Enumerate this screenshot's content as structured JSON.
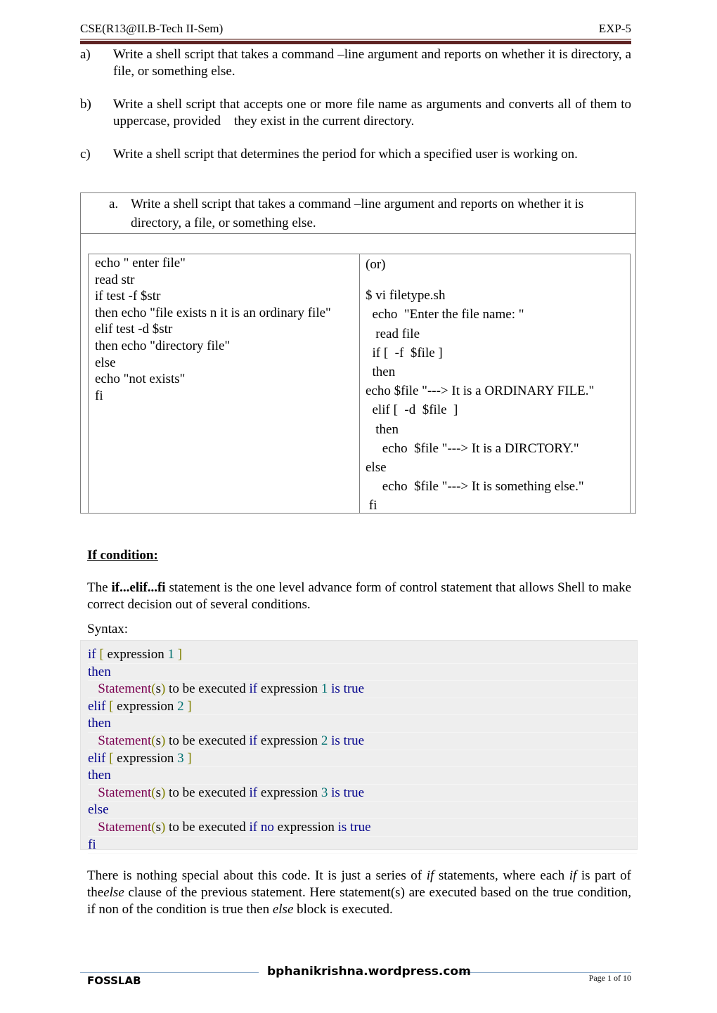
{
  "header": {
    "left": "CSE(R13@II.B-Tech II-Sem)",
    "right": "EXP-5"
  },
  "tasks": [
    {
      "mark": "a)",
      "text": "Write a shell script that takes a command –line argument and reports on whether it is directory, a file, or something else."
    },
    {
      "mark": "b)",
      "text": "Write a shell script that accepts one or more file name as arguments and converts all of them to uppercase, provided    they exist in the current directory."
    },
    {
      "mark": "c)",
      "text": "Write a shell script that determines the period for which a specified user is working on."
    }
  ],
  "outer_table": {
    "mark": "a.",
    "text": "Write a shell script that takes a command –line argument and reports on whether it is directory, a file, or something else."
  },
  "left_code": [
    "echo \" enter file\"",
    "read str",
    "if test -f $str",
    "then echo \"file exists n it is an ordinary file\"",
    "elif test -d $str",
    "then echo \"directory file\"",
    "else",
    "echo \"not exists\"",
    "fi"
  ],
  "right_code": {
    "or_label": "(or)",
    "lines": [
      "$ vi filetype.sh",
      "  echo  \"Enter the file name: \"",
      "   read file",
      "  if [  -f  $file ]",
      "  then",
      "echo $file \"---> It is a ORDINARY FILE.\"",
      "  elif [  -d  $file  ]",
      "   then",
      "     echo  $file \"---> It is a DIRCTORY.\"",
      "else",
      "     echo  $file \"---> It is something else.\"",
      " fi"
    ]
  },
  "if_section": {
    "heading": "If condition:",
    "intro_prefix": "The ",
    "intro_bold": "if...elif...fi",
    "intro_suffix": " statement is the one level advance form of control statement that allows Shell to make correct decision out of several conditions.",
    "syntax_label": "Syntax:"
  },
  "syntax_code": [
    [
      {
        "t": "if",
        "c": "kw"
      },
      {
        "t": " ",
        "c": "plain"
      },
      {
        "t": "[",
        "c": "br"
      },
      {
        "t": " expression ",
        "c": "plain"
      },
      {
        "t": "1",
        "c": "num"
      },
      {
        "t": " ",
        "c": "plain"
      },
      {
        "t": "]",
        "c": "br"
      }
    ],
    [
      {
        "t": "then",
        "c": "kw"
      }
    ],
    [
      {
        "t": "   Statement",
        "c": "stmt"
      },
      {
        "t": "(",
        "c": "br"
      },
      {
        "t": "s",
        "c": "plain"
      },
      {
        "t": ")",
        "c": "br"
      },
      {
        "t": " to be executed ",
        "c": "plain"
      },
      {
        "t": "if",
        "c": "kw"
      },
      {
        "t": " expression ",
        "c": "plain"
      },
      {
        "t": "1",
        "c": "num"
      },
      {
        "t": " ",
        "c": "plain"
      },
      {
        "t": "is true",
        "c": "kw"
      }
    ],
    [
      {
        "t": "elif",
        "c": "kw"
      },
      {
        "t": " ",
        "c": "plain"
      },
      {
        "t": "[",
        "c": "br"
      },
      {
        "t": " expression ",
        "c": "plain"
      },
      {
        "t": "2",
        "c": "num"
      },
      {
        "t": " ",
        "c": "plain"
      },
      {
        "t": "]",
        "c": "br"
      }
    ],
    [
      {
        "t": "then",
        "c": "kw"
      }
    ],
    [
      {
        "t": "   Statement",
        "c": "stmt"
      },
      {
        "t": "(",
        "c": "br"
      },
      {
        "t": "s",
        "c": "plain"
      },
      {
        "t": ")",
        "c": "br"
      },
      {
        "t": " to be executed ",
        "c": "plain"
      },
      {
        "t": "if",
        "c": "kw"
      },
      {
        "t": " expression ",
        "c": "plain"
      },
      {
        "t": "2",
        "c": "num"
      },
      {
        "t": " ",
        "c": "plain"
      },
      {
        "t": "is true",
        "c": "kw"
      }
    ],
    [
      {
        "t": "elif",
        "c": "kw"
      },
      {
        "t": " ",
        "c": "plain"
      },
      {
        "t": "[",
        "c": "br"
      },
      {
        "t": " expression ",
        "c": "plain"
      },
      {
        "t": "3",
        "c": "num"
      },
      {
        "t": " ",
        "c": "plain"
      },
      {
        "t": "]",
        "c": "br"
      }
    ],
    [
      {
        "t": "then",
        "c": "kw"
      }
    ],
    [
      {
        "t": "   Statement",
        "c": "stmt"
      },
      {
        "t": "(",
        "c": "br"
      },
      {
        "t": "s",
        "c": "plain"
      },
      {
        "t": ")",
        "c": "br"
      },
      {
        "t": " to be executed ",
        "c": "plain"
      },
      {
        "t": "if",
        "c": "kw"
      },
      {
        "t": " expression ",
        "c": "plain"
      },
      {
        "t": "3",
        "c": "num"
      },
      {
        "t": " ",
        "c": "plain"
      },
      {
        "t": "is true",
        "c": "kw"
      }
    ],
    [
      {
        "t": "else",
        "c": "kw"
      }
    ],
    [
      {
        "t": "   Statement",
        "c": "stmt"
      },
      {
        "t": "(",
        "c": "br"
      },
      {
        "t": "s",
        "c": "plain"
      },
      {
        "t": ")",
        "c": "br"
      },
      {
        "t": " to be executed ",
        "c": "plain"
      },
      {
        "t": "if no",
        "c": "kw"
      },
      {
        "t": " expression ",
        "c": "plain"
      },
      {
        "t": "is true",
        "c": "kw"
      }
    ],
    [
      {
        "t": "fi",
        "c": "kw"
      }
    ]
  ],
  "closing": {
    "p1": "There is nothing special about this code. It is just a series of ",
    "i1": "if",
    "p2": " statements, where each ",
    "i2": "if",
    "p3": " is part of the",
    "i3": "else",
    "p4": " clause of the previous statement. Here statement(s) are executed based on the true condition, if non of the condition is true then ",
    "i4": "else",
    "p5": " block is executed."
  },
  "footer": {
    "lab": "FOSSLAB",
    "site": "bphanikrishna.wordpress.com",
    "page": "Page 1 of 10"
  }
}
